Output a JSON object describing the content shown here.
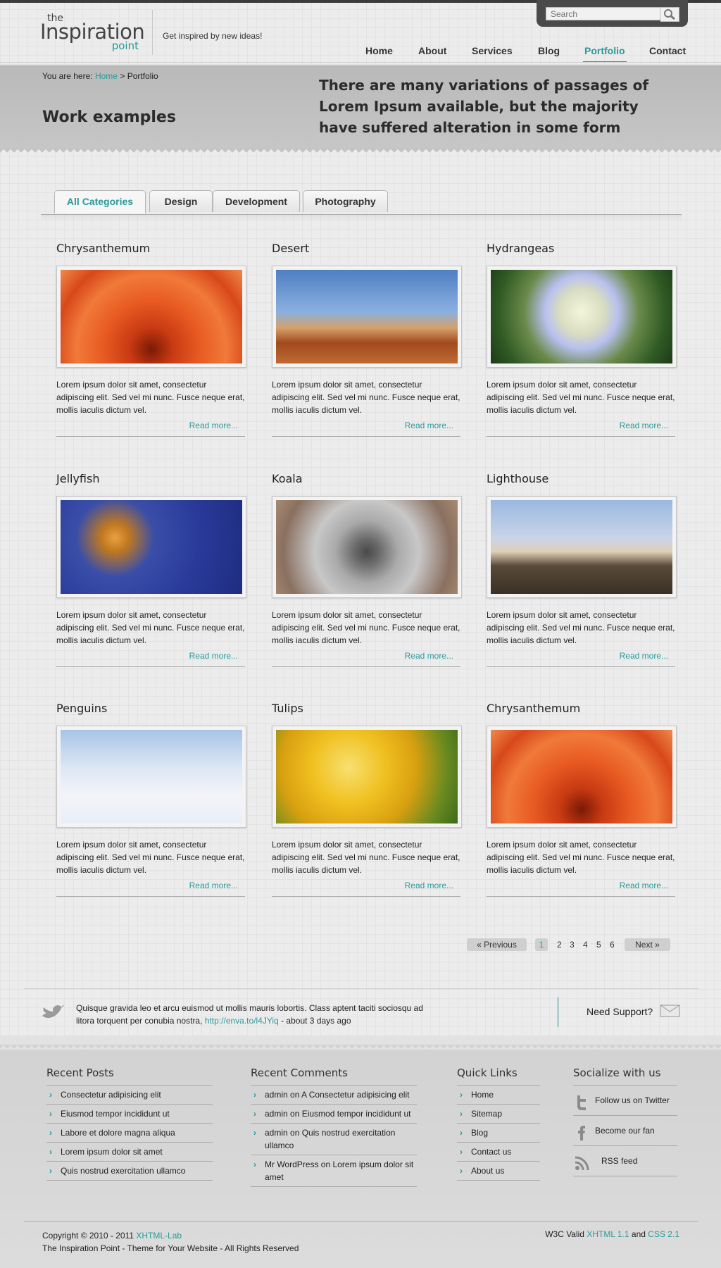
{
  "logo": {
    "the": "the",
    "main": "Inspiration",
    "point": "point"
  },
  "tagline": "Get inspired by new ideas!",
  "search": {
    "placeholder": "Search"
  },
  "nav": {
    "items": [
      "Home",
      "About",
      "Services",
      "Blog",
      "Portfolio",
      "Contact"
    ],
    "active": "Portfolio"
  },
  "breadcrumb": {
    "prefix": "You are here:",
    "home": "Home",
    "sep": ">",
    "current": "Portfolio"
  },
  "banner": {
    "title": "Work examples",
    "quote": "There are many variations of passages of Lorem Ipsum available, but the majority have suffered alteration in some form"
  },
  "tabs": [
    "All Categories",
    "Design",
    "Development",
    "Photography"
  ],
  "active_tab": "All Categories",
  "card_text": "Lorem ipsum dolor sit amet, consectetur adipiscing elit. Sed vel mi nunc. Fusce neque erat, mollis iaculis dictum vel.",
  "read_more": "Read more...",
  "cards": [
    {
      "title": "Chrysanthemum",
      "img": "chrysanthemum"
    },
    {
      "title": "Desert",
      "img": "desert"
    },
    {
      "title": "Hydrangeas",
      "img": "hydrangeas"
    },
    {
      "title": "Jellyfish",
      "img": "jellyfish"
    },
    {
      "title": "Koala",
      "img": "koala"
    },
    {
      "title": "Lighthouse",
      "img": "lighthouse"
    },
    {
      "title": "Penguins",
      "img": "penguins"
    },
    {
      "title": "Tulips",
      "img": "tulips"
    },
    {
      "title": "Chrysanthemum",
      "img": "chrysanthemum"
    }
  ],
  "pagination": {
    "prev": "Previous",
    "next": "Next",
    "pages": [
      "1",
      "2",
      "3",
      "4",
      "5",
      "6"
    ],
    "current": "1"
  },
  "tweet": {
    "text": "Quisque gravida leo et arcu euismod ut mollis mauris lobortis. Class aptent taciti sociosqu ad litora torquent per conubia nostra,",
    "link": "http://enva.to/l4JYiq",
    "time": "- about 3 days ago"
  },
  "support": "Need Support?",
  "footer": {
    "recent_posts": {
      "title": "Recent Posts",
      "items": [
        "Consectetur adipisicing  elit",
        "Eiusmod tempor incididunt ut",
        "Labore et dolore magna aliqua",
        "Lorem ipsum dolor sit amet",
        "Quis nostrud exercitation ullamco"
      ]
    },
    "recent_comments": {
      "title": "Recent Comments",
      "items": [
        "admin on A Consectetur adipisicing  elit",
        "admin on Eiusmod tempor incididunt ut",
        "admin on Quis nostrud exercitation ullamco",
        "Mr WordPress on Lorem ipsum dolor sit amet"
      ]
    },
    "quick_links": {
      "title": "Quick Links",
      "items": [
        "Home",
        "Sitemap",
        "Blog",
        "Contact us",
        "About us"
      ]
    },
    "social": {
      "title": "Socialize with us",
      "items": [
        "Follow us on Twitter",
        "Become our fan",
        "RSS feed"
      ]
    }
  },
  "copyright": {
    "line1_prefix": "Copyright © 2010 - 2011",
    "line1_link": "XHTML-Lab",
    "line2": "The Inspiration Point - Theme for Your Website - All Rights Reserved"
  },
  "valid": {
    "prefix": "W3C Valid",
    "xhtml": "XHTML 1.1",
    "and": "and",
    "css": "CSS 2.1"
  },
  "colors": {
    "accent": "#2a9a9a",
    "banner": "#bfbfbf",
    "footer": "#d6d6d6"
  }
}
